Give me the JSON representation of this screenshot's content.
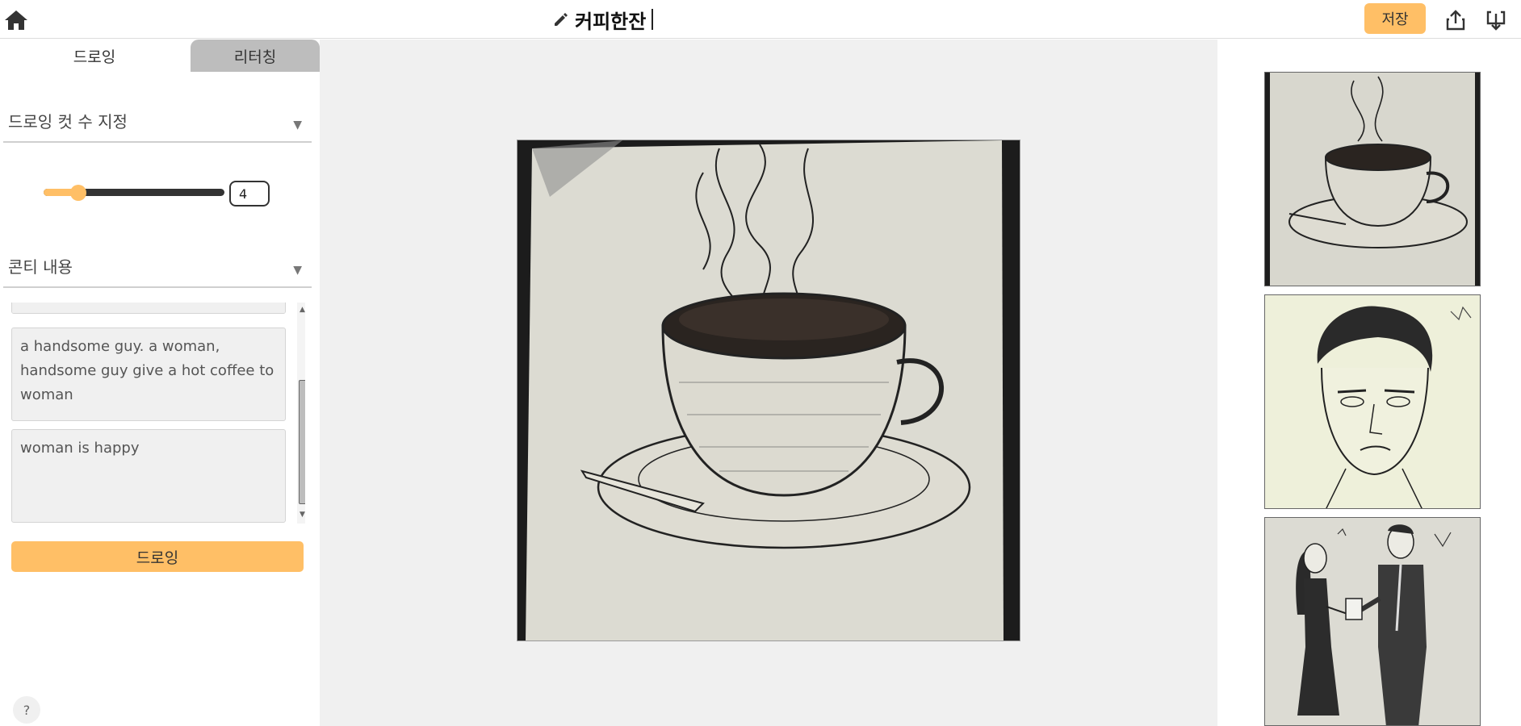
{
  "header": {
    "title": "커피한잔",
    "save_label": "저장"
  },
  "icons": {
    "home": "home-icon",
    "edit": "pencil-icon",
    "share": "share-icon",
    "download": "download-icon"
  },
  "tabs": [
    {
      "label": "드로잉",
      "active": true
    },
    {
      "label": "리터칭",
      "active": false
    }
  ],
  "drawing": {
    "count_select_label": "드로잉 컷 수 지정",
    "count_value": "4",
    "slider_fraction": 0.16,
    "conti_select_label": "콘티 내용",
    "conti_items": [
      "",
      "a handsome guy. a woman, handsome guy give a hot coffee to woman",
      "woman is happy"
    ],
    "draw_button_label": "드로잉"
  },
  "help_label": "?",
  "colors": {
    "accent": "#ffbf66",
    "canvas_bg": "#f0f0f0",
    "tab_inactive": "#bdbdbd"
  }
}
